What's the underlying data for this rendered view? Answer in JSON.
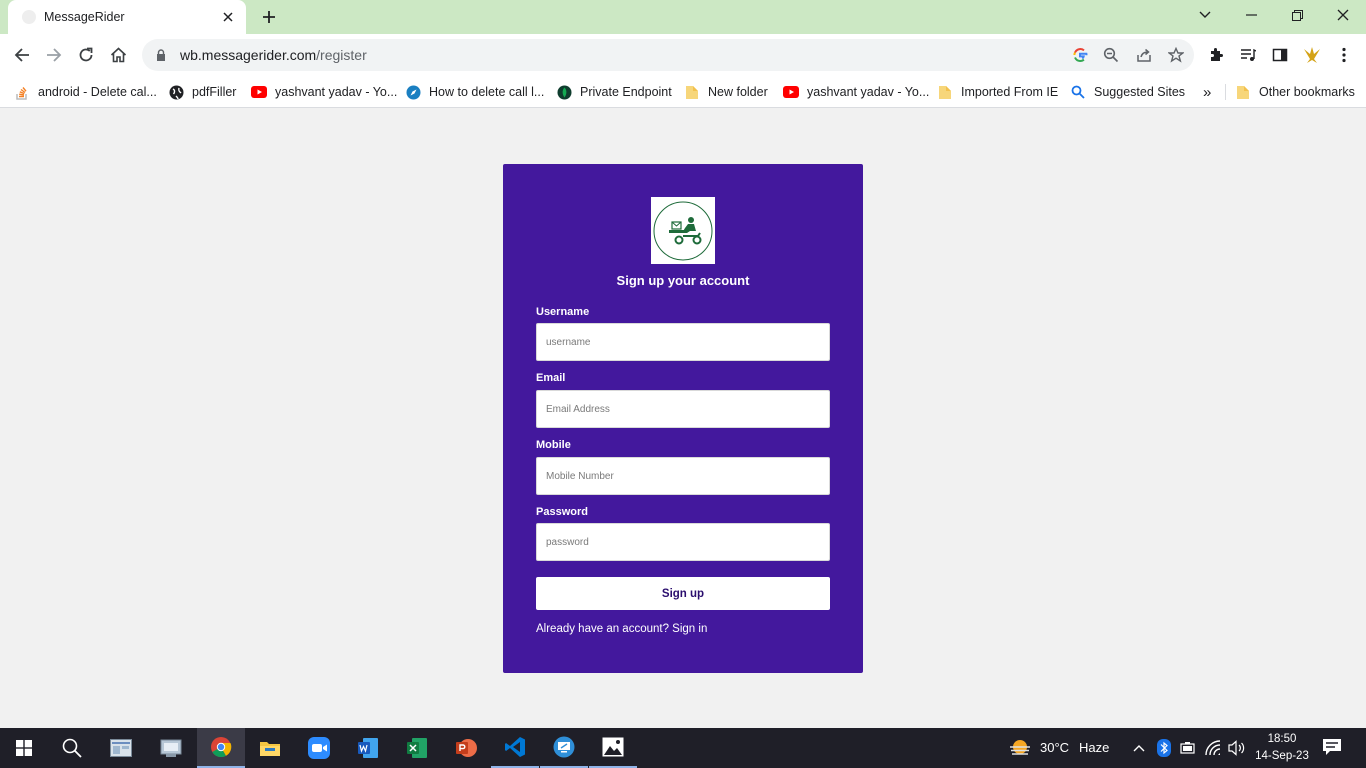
{
  "browser": {
    "tab_title": "MessageRider",
    "url_host": "wb.messagerider.com",
    "url_path": "/register",
    "bookmarks": [
      {
        "label": "android - Delete cal...",
        "icon": "stackoverflow-icon"
      },
      {
        "label": "pdfFiller",
        "icon": "globe-icon"
      },
      {
        "label": "yashvant yadav - Yo...",
        "icon": "youtube-icon"
      },
      {
        "label": "How to delete call l...",
        "icon": "compass-icon"
      },
      {
        "label": "Private Endpoint",
        "icon": "leaf-icon"
      },
      {
        "label": "New folder",
        "icon": "folder-icon"
      },
      {
        "label": "yashvant yadav - Yo...",
        "icon": "youtube-icon"
      },
      {
        "label": "Imported From IE",
        "icon": "folder-icon"
      },
      {
        "label": "Suggested Sites",
        "icon": "search-icon"
      }
    ],
    "overflow": "»",
    "other_bookmarks": "Other bookmarks"
  },
  "form": {
    "title": "Sign up your account",
    "username_label": "Username",
    "username_placeholder": "username",
    "email_label": "Email",
    "email_placeholder": "Email Address",
    "mobile_label": "Mobile",
    "mobile_placeholder": "Mobile Number",
    "password_label": "Password",
    "password_placeholder": "password",
    "submit_label": "Sign up",
    "signin_text": "Already have an account? Sign in"
  },
  "colors": {
    "card": "#43189d",
    "tab_strip": "#cce8c4",
    "logo_green": "#1e6b3a"
  },
  "taskbar": {
    "weather_temp": "30°C",
    "weather_desc": "Haze",
    "time": "18:50",
    "date": "14-Sep-23"
  }
}
